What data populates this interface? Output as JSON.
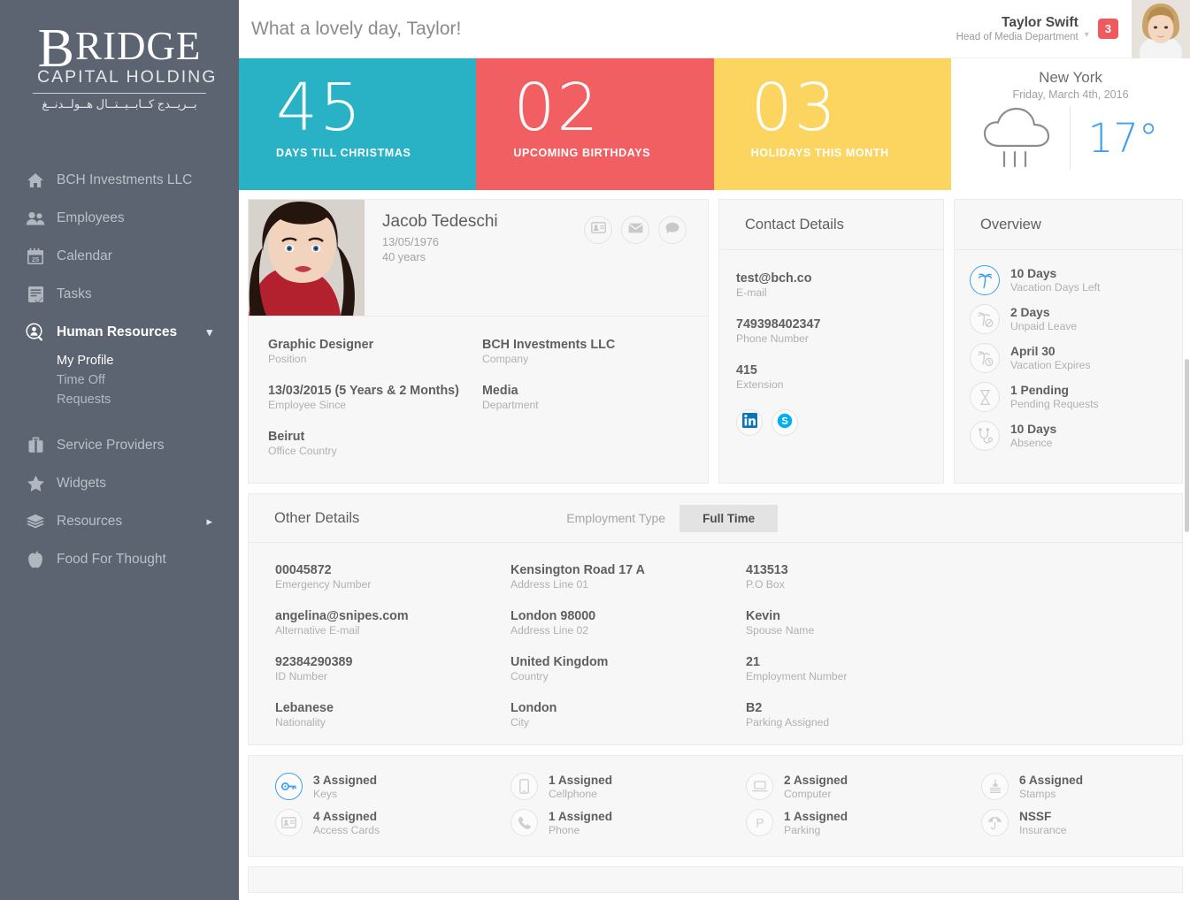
{
  "brand": {
    "logo_main": "RIDGE",
    "logo_initial": "B",
    "logo_sub": "CAPITAL HOLDING",
    "logo_arabic": "بــريــدج كــابــيــتــال هــولــدنــغ"
  },
  "sidebar": {
    "items": [
      {
        "label": "BCH Investments LLC",
        "icon": "home-icon"
      },
      {
        "label": "Employees",
        "icon": "people-icon"
      },
      {
        "label": "Calendar",
        "icon": "calendar-icon"
      },
      {
        "label": "Tasks",
        "icon": "tasks-icon"
      },
      {
        "label": "Human Resources",
        "icon": "person-search-icon"
      },
      {
        "label": "Service Providers",
        "icon": "briefcase-icon"
      },
      {
        "label": "Widgets",
        "icon": "star-icon"
      },
      {
        "label": "Resources",
        "icon": "layers-icon"
      },
      {
        "label": "Food For Thought",
        "icon": "apple-icon"
      }
    ],
    "sub_items": [
      {
        "label": "My Profile",
        "active": true
      },
      {
        "label": "Time Off",
        "active": false
      },
      {
        "label": "Requests",
        "active": false
      }
    ]
  },
  "topbar": {
    "greeting": "What a lovely day, Taylor!",
    "user_name": "Taylor Swift",
    "user_role": "Head of Media Department",
    "notification_count": "3"
  },
  "stats": [
    {
      "number": "45",
      "label": "DAYS TILL CHRISTMAS",
      "color": "#29b2c6"
    },
    {
      "number": "02",
      "label": "UPCOMING BIRTHDAYS",
      "color": "#f15f63"
    },
    {
      "number": "03",
      "label": "HOLIDAYS THIS MONTH",
      "color": "#fbd560"
    }
  ],
  "weather": {
    "city": "New York",
    "date": "Friday, March 4th, 2016",
    "temperature": "17°",
    "icon": "rain-cloud-icon",
    "temp_color": "#3ba0f0"
  },
  "profile": {
    "name": "Jacob Tedeschi",
    "dob": "13/05/1976",
    "age": "40 years",
    "actions": [
      {
        "icon": "contact-card-icon"
      },
      {
        "icon": "envelope-icon"
      },
      {
        "icon": "chat-bubble-icon"
      }
    ],
    "fields_left": [
      {
        "value": "Graphic Designer",
        "label": "Position"
      },
      {
        "value": "13/03/2015 (5 Years & 2 Months)",
        "label": "Employee Since"
      },
      {
        "value": "Beirut",
        "label": "Office Country"
      }
    ],
    "fields_right": [
      {
        "value": "BCH Investments LLC",
        "label": "Company"
      },
      {
        "value": "Media",
        "label": "Department"
      }
    ]
  },
  "contact": {
    "title": "Contact Details",
    "fields": [
      {
        "value": "test@bch.co",
        "label": "E-mail"
      },
      {
        "value": "749398402347",
        "label": "Phone Number"
      },
      {
        "value": "415",
        "label": "Extension"
      }
    ],
    "social": [
      {
        "icon": "linkedin-icon",
        "color": "#0a75b6"
      },
      {
        "icon": "skype-icon",
        "color": "#00aff0"
      }
    ]
  },
  "overview": {
    "title": "Overview",
    "items": [
      {
        "value": "10 Days",
        "label": "Vacation Days Left",
        "icon": "palm-tree-icon",
        "highlight": true
      },
      {
        "value": "2 Days",
        "label": "Unpaid Leave",
        "icon": "palm-tree-blocked-icon",
        "highlight": false
      },
      {
        "value": "April 30",
        "label": "Vacation Expires",
        "icon": "palm-tree-clock-icon",
        "highlight": false
      },
      {
        "value": "1 Pending",
        "label": "Pending Requests",
        "icon": "hourglass-icon",
        "highlight": false
      },
      {
        "value": "10 Days",
        "label": "Absence",
        "icon": "stethoscope-icon",
        "highlight": false
      }
    ]
  },
  "other_details": {
    "title": "Other Details",
    "employment_type_label": "Employment Type",
    "employment_type_value": "Full Time",
    "col1": [
      {
        "value": "00045872",
        "label": "Emergency Number"
      },
      {
        "value": "angelina@snipes.com",
        "label": "Alternative E-mail"
      },
      {
        "value": "92384290389",
        "label": "ID Number"
      },
      {
        "value": "Lebanese",
        "label": "Nationality"
      }
    ],
    "col2": [
      {
        "value": "Kensington Road 17 A",
        "label": "Address Line 01"
      },
      {
        "value": "London 98000",
        "label": "Address Line 02"
      },
      {
        "value": "United Kingdom",
        "label": "Country"
      },
      {
        "value": "London",
        "label": "City"
      }
    ],
    "col3": [
      {
        "value": "413513",
        "label": "P.O Box"
      },
      {
        "value": "Kevin",
        "label": "Spouse Name"
      },
      {
        "value": "21",
        "label": "Employment Number"
      },
      {
        "value": "B2",
        "label": "Parking Assigned"
      }
    ]
  },
  "assets": {
    "col1": [
      {
        "value": "3 Assigned",
        "label": "Keys",
        "icon": "key-icon",
        "highlight": true
      },
      {
        "value": "4 Assigned",
        "label": "Access Cards",
        "icon": "access-card-icon",
        "highlight": false
      }
    ],
    "col2": [
      {
        "value": "1 Assigned",
        "label": "Cellphone",
        "icon": "cellphone-icon",
        "highlight": false
      },
      {
        "value": "1 Assigned",
        "label": "Phone",
        "icon": "phone-icon",
        "highlight": false
      }
    ],
    "col3": [
      {
        "value": "2 Assigned",
        "label": "Computer",
        "icon": "computer-icon",
        "highlight": false
      },
      {
        "value": "1 Assigned",
        "label": "Parking",
        "icon": "parking-icon",
        "highlight": false
      }
    ],
    "col4": [
      {
        "value": "6 Assigned",
        "label": "Stamps",
        "icon": "stamp-icon",
        "highlight": false
      },
      {
        "value": "NSSF",
        "label": "Insurance",
        "icon": "umbrella-icon",
        "highlight": false
      }
    ]
  },
  "colors": {
    "sidebar_bg": "#5b6470",
    "accent_blue": "#3ba0f0",
    "teal": "#29b2c6",
    "red": "#f15f63",
    "yellow": "#fbd560"
  }
}
